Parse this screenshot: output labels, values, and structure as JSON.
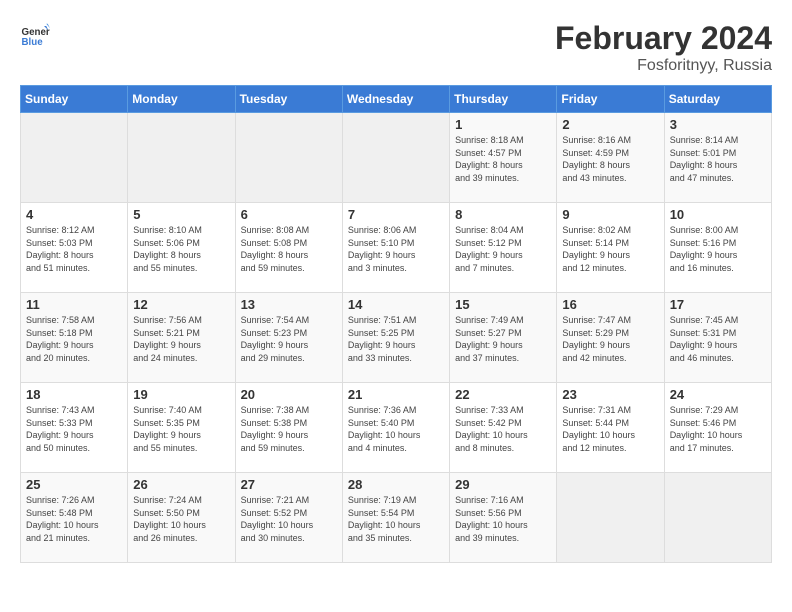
{
  "header": {
    "logo_general": "General",
    "logo_blue": "Blue",
    "month_year": "February 2024",
    "location": "Fosforitnyy, Russia"
  },
  "days_of_week": [
    "Sunday",
    "Monday",
    "Tuesday",
    "Wednesday",
    "Thursday",
    "Friday",
    "Saturday"
  ],
  "weeks": [
    [
      {
        "day": "",
        "info": ""
      },
      {
        "day": "",
        "info": ""
      },
      {
        "day": "",
        "info": ""
      },
      {
        "day": "",
        "info": ""
      },
      {
        "day": "1",
        "info": "Sunrise: 8:18 AM\nSunset: 4:57 PM\nDaylight: 8 hours\nand 39 minutes."
      },
      {
        "day": "2",
        "info": "Sunrise: 8:16 AM\nSunset: 4:59 PM\nDaylight: 8 hours\nand 43 minutes."
      },
      {
        "day": "3",
        "info": "Sunrise: 8:14 AM\nSunset: 5:01 PM\nDaylight: 8 hours\nand 47 minutes."
      }
    ],
    [
      {
        "day": "4",
        "info": "Sunrise: 8:12 AM\nSunset: 5:03 PM\nDaylight: 8 hours\nand 51 minutes."
      },
      {
        "day": "5",
        "info": "Sunrise: 8:10 AM\nSunset: 5:06 PM\nDaylight: 8 hours\nand 55 minutes."
      },
      {
        "day": "6",
        "info": "Sunrise: 8:08 AM\nSunset: 5:08 PM\nDaylight: 8 hours\nand 59 minutes."
      },
      {
        "day": "7",
        "info": "Sunrise: 8:06 AM\nSunset: 5:10 PM\nDaylight: 9 hours\nand 3 minutes."
      },
      {
        "day": "8",
        "info": "Sunrise: 8:04 AM\nSunset: 5:12 PM\nDaylight: 9 hours\nand 7 minutes."
      },
      {
        "day": "9",
        "info": "Sunrise: 8:02 AM\nSunset: 5:14 PM\nDaylight: 9 hours\nand 12 minutes."
      },
      {
        "day": "10",
        "info": "Sunrise: 8:00 AM\nSunset: 5:16 PM\nDaylight: 9 hours\nand 16 minutes."
      }
    ],
    [
      {
        "day": "11",
        "info": "Sunrise: 7:58 AM\nSunset: 5:18 PM\nDaylight: 9 hours\nand 20 minutes."
      },
      {
        "day": "12",
        "info": "Sunrise: 7:56 AM\nSunset: 5:21 PM\nDaylight: 9 hours\nand 24 minutes."
      },
      {
        "day": "13",
        "info": "Sunrise: 7:54 AM\nSunset: 5:23 PM\nDaylight: 9 hours\nand 29 minutes."
      },
      {
        "day": "14",
        "info": "Sunrise: 7:51 AM\nSunset: 5:25 PM\nDaylight: 9 hours\nand 33 minutes."
      },
      {
        "day": "15",
        "info": "Sunrise: 7:49 AM\nSunset: 5:27 PM\nDaylight: 9 hours\nand 37 minutes."
      },
      {
        "day": "16",
        "info": "Sunrise: 7:47 AM\nSunset: 5:29 PM\nDaylight: 9 hours\nand 42 minutes."
      },
      {
        "day": "17",
        "info": "Sunrise: 7:45 AM\nSunset: 5:31 PM\nDaylight: 9 hours\nand 46 minutes."
      }
    ],
    [
      {
        "day": "18",
        "info": "Sunrise: 7:43 AM\nSunset: 5:33 PM\nDaylight: 9 hours\nand 50 minutes."
      },
      {
        "day": "19",
        "info": "Sunrise: 7:40 AM\nSunset: 5:35 PM\nDaylight: 9 hours\nand 55 minutes."
      },
      {
        "day": "20",
        "info": "Sunrise: 7:38 AM\nSunset: 5:38 PM\nDaylight: 9 hours\nand 59 minutes."
      },
      {
        "day": "21",
        "info": "Sunrise: 7:36 AM\nSunset: 5:40 PM\nDaylight: 10 hours\nand 4 minutes."
      },
      {
        "day": "22",
        "info": "Sunrise: 7:33 AM\nSunset: 5:42 PM\nDaylight: 10 hours\nand 8 minutes."
      },
      {
        "day": "23",
        "info": "Sunrise: 7:31 AM\nSunset: 5:44 PM\nDaylight: 10 hours\nand 12 minutes."
      },
      {
        "day": "24",
        "info": "Sunrise: 7:29 AM\nSunset: 5:46 PM\nDaylight: 10 hours\nand 17 minutes."
      }
    ],
    [
      {
        "day": "25",
        "info": "Sunrise: 7:26 AM\nSunset: 5:48 PM\nDaylight: 10 hours\nand 21 minutes."
      },
      {
        "day": "26",
        "info": "Sunrise: 7:24 AM\nSunset: 5:50 PM\nDaylight: 10 hours\nand 26 minutes."
      },
      {
        "day": "27",
        "info": "Sunrise: 7:21 AM\nSunset: 5:52 PM\nDaylight: 10 hours\nand 30 minutes."
      },
      {
        "day": "28",
        "info": "Sunrise: 7:19 AM\nSunset: 5:54 PM\nDaylight: 10 hours\nand 35 minutes."
      },
      {
        "day": "29",
        "info": "Sunrise: 7:16 AM\nSunset: 5:56 PM\nDaylight: 10 hours\nand 39 minutes."
      },
      {
        "day": "",
        "info": ""
      },
      {
        "day": "",
        "info": ""
      }
    ]
  ]
}
